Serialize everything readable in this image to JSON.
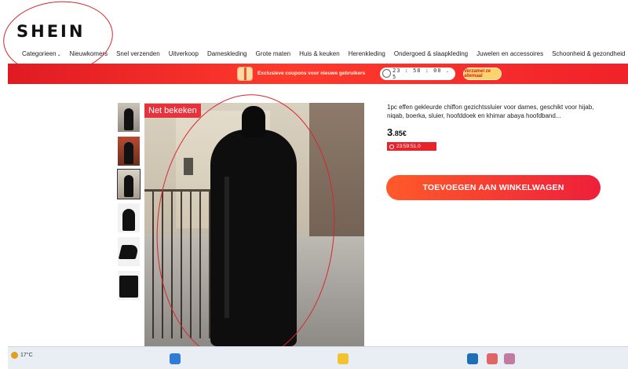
{
  "header": {
    "logo": "SHEIN",
    "nav": [
      "Categorieen",
      "Nieuwkomers",
      "Snel verzenden",
      "Uitverkoop",
      "Dameskleding",
      "Grote maten",
      "Huis & keuken",
      "Herenkleding",
      "Ondergoed & slaapkleding",
      "Juwelen en accessoires",
      "Schoonheid & gezondheid"
    ]
  },
  "banner": {
    "text": "Exclusieve coupons voor nieuwe gebruikers",
    "timer": "23 : 58 : 00 . 5",
    "claim": "Verzamel ze allemaal",
    "colors": {
      "background": "#e8232c",
      "claim_bg": "#ffd36b"
    }
  },
  "gallery": {
    "badge": "Net bekeken",
    "thumbnail_count": 6,
    "selected_index": 3
  },
  "product": {
    "title": "1pc effen gekleurde chiffon gezichtssluier voor dames, geschikt voor hijab, niqab, boerka, sluier, hoofddoek en khimar abaya hoofdband...",
    "price_main": "3",
    "price_rest": ".85€",
    "countdown": "23:59:51.0",
    "add_button": "TOEVOEGEN AAN WINKELWAGEN",
    "button_color": "#f5312e"
  },
  "taskbar": {
    "temperature": "17°C"
  }
}
